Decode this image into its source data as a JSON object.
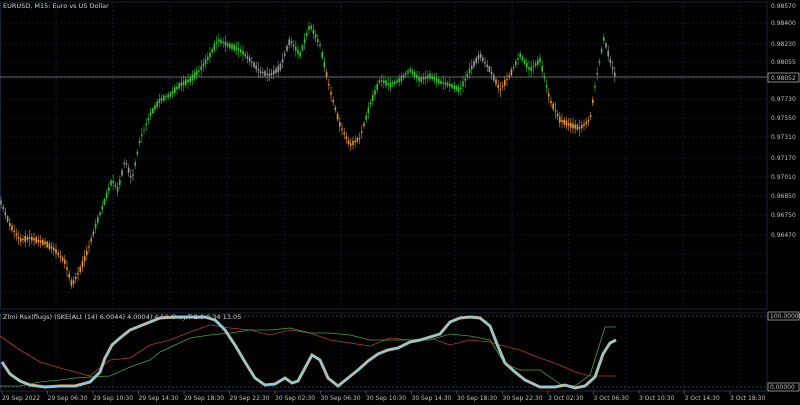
{
  "window": {
    "title": "EURUSD, M15: Euro vs US Dollar"
  },
  "main_chart": {
    "symbol": "EURUSD",
    "timeframe": "M15",
    "current_price": "0.98052",
    "price_ticks": [
      "0.98570",
      "0.98400",
      "0.98230",
      "0.98055",
      "0.97890",
      "0.97730",
      "0.97550",
      "0.97310",
      "0.97170",
      "0.97010",
      "0.96850",
      "0.96750",
      "0.96470"
    ],
    "colors": {
      "up": "#2ec52e",
      "down": "#e8962a",
      "neutral": "#9a9a9a",
      "grid": "#1e2c4a",
      "price_line": "#8a8a8a"
    }
  },
  "indicator": {
    "title": "Zlmi Rsx(flugs) (SKE(ALt (14) 6.0044) 4.0004) 4.50 Gray.T 2.0 0.34 13.05",
    "top_level": "100.00000",
    "bottom_level": "0.00000",
    "colors": {
      "main_light": "#7ad0f0",
      "main_orange": "#ff9a3c",
      "red_line": "#c03a20",
      "green_line": "#3aa83a"
    }
  },
  "time_axis": {
    "labels": [
      "29 Sep 2022",
      "29 Sep 06:30",
      "29 Sep 10:30",
      "29 Sep 14:30",
      "29 Sep 18:30",
      "29 Sep 22:30",
      "30 Sep 02:30",
      "30 Sep 06:30",
      "30 Sep 10:30",
      "30 Sep 14:30",
      "30 Sep 18:30",
      "30 Sep 22:30",
      "3 Oct 02:30",
      "3 Oct 06:30",
      "3 Oct 10:30",
      "3 Oct 14:30",
      "3 Oct 18:30"
    ]
  }
}
